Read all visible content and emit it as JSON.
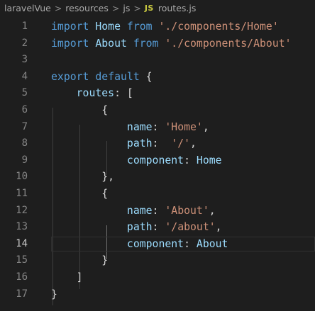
{
  "breadcrumb": {
    "items": [
      "laravelVue",
      "resources",
      "js"
    ],
    "separator": ">",
    "file_icon": "JS",
    "file_name": "routes.js"
  },
  "code": {
    "active_line": 14,
    "lines": [
      {
        "num": "1",
        "tokens": [
          {
            "t": "import",
            "c": "kw"
          },
          {
            "t": " Home ",
            "c": "prop"
          },
          {
            "t": "from",
            "c": "kw"
          },
          {
            "t": " ",
            "c": "punc"
          },
          {
            "t": "'./components/Home'",
            "c": "str"
          }
        ]
      },
      {
        "num": "2",
        "tokens": [
          {
            "t": "import",
            "c": "kw"
          },
          {
            "t": " About ",
            "c": "prop"
          },
          {
            "t": "from",
            "c": "kw"
          },
          {
            "t": " ",
            "c": "punc"
          },
          {
            "t": "'./components/About'",
            "c": "str"
          }
        ]
      },
      {
        "num": "3",
        "tokens": []
      },
      {
        "num": "4",
        "tokens": [
          {
            "t": "export",
            "c": "kw"
          },
          {
            "t": " ",
            "c": "punc"
          },
          {
            "t": "default",
            "c": "kw"
          },
          {
            "t": " {",
            "c": "punc"
          }
        ]
      },
      {
        "num": "5",
        "tokens": [
          {
            "t": "    ",
            "c": "punc"
          },
          {
            "t": "routes",
            "c": "prop"
          },
          {
            "t": ": [",
            "c": "punc"
          }
        ]
      },
      {
        "num": "6",
        "tokens": [
          {
            "t": "        {",
            "c": "punc"
          }
        ]
      },
      {
        "num": "7",
        "tokens": [
          {
            "t": "            ",
            "c": "punc"
          },
          {
            "t": "name",
            "c": "prop"
          },
          {
            "t": ": ",
            "c": "punc"
          },
          {
            "t": "'Home'",
            "c": "str"
          },
          {
            "t": ",",
            "c": "punc"
          }
        ]
      },
      {
        "num": "8",
        "tokens": [
          {
            "t": "            ",
            "c": "punc"
          },
          {
            "t": "path",
            "c": "prop"
          },
          {
            "t": ":  ",
            "c": "punc"
          },
          {
            "t": "'/'",
            "c": "str"
          },
          {
            "t": ",",
            "c": "punc"
          }
        ]
      },
      {
        "num": "9",
        "tokens": [
          {
            "t": "            ",
            "c": "punc"
          },
          {
            "t": "component",
            "c": "prop"
          },
          {
            "t": ": ",
            "c": "punc"
          },
          {
            "t": "Home",
            "c": "prop"
          }
        ]
      },
      {
        "num": "10",
        "tokens": [
          {
            "t": "        },",
            "c": "punc"
          }
        ]
      },
      {
        "num": "11",
        "tokens": [
          {
            "t": "        {",
            "c": "punc"
          }
        ]
      },
      {
        "num": "12",
        "tokens": [
          {
            "t": "            ",
            "c": "punc"
          },
          {
            "t": "name",
            "c": "prop"
          },
          {
            "t": ": ",
            "c": "punc"
          },
          {
            "t": "'About'",
            "c": "str"
          },
          {
            "t": ",",
            "c": "punc"
          }
        ]
      },
      {
        "num": "13",
        "tokens": [
          {
            "t": "            ",
            "c": "punc"
          },
          {
            "t": "path",
            "c": "prop"
          },
          {
            "t": ": ",
            "c": "punc"
          },
          {
            "t": "'/about'",
            "c": "str"
          },
          {
            "t": ",",
            "c": "punc"
          }
        ]
      },
      {
        "num": "14",
        "tokens": [
          {
            "t": "            ",
            "c": "punc"
          },
          {
            "t": "component",
            "c": "prop"
          },
          {
            "t": ": ",
            "c": "punc"
          },
          {
            "t": "About",
            "c": "prop"
          }
        ]
      },
      {
        "num": "15",
        "tokens": [
          {
            "t": "        }",
            "c": "punc"
          }
        ]
      },
      {
        "num": "16",
        "tokens": [
          {
            "t": "    ]",
            "c": "punc"
          }
        ]
      },
      {
        "num": "17",
        "tokens": [
          {
            "t": "}",
            "c": "punc"
          }
        ]
      }
    ]
  },
  "colors": {
    "background": "#1e1e1e",
    "keyword": "#569cd6",
    "string": "#ce9178",
    "identifier": "#9cdcfe",
    "punctuation": "#d4d4d4",
    "line_number": "#858585",
    "js_icon": "#cbcb41"
  }
}
